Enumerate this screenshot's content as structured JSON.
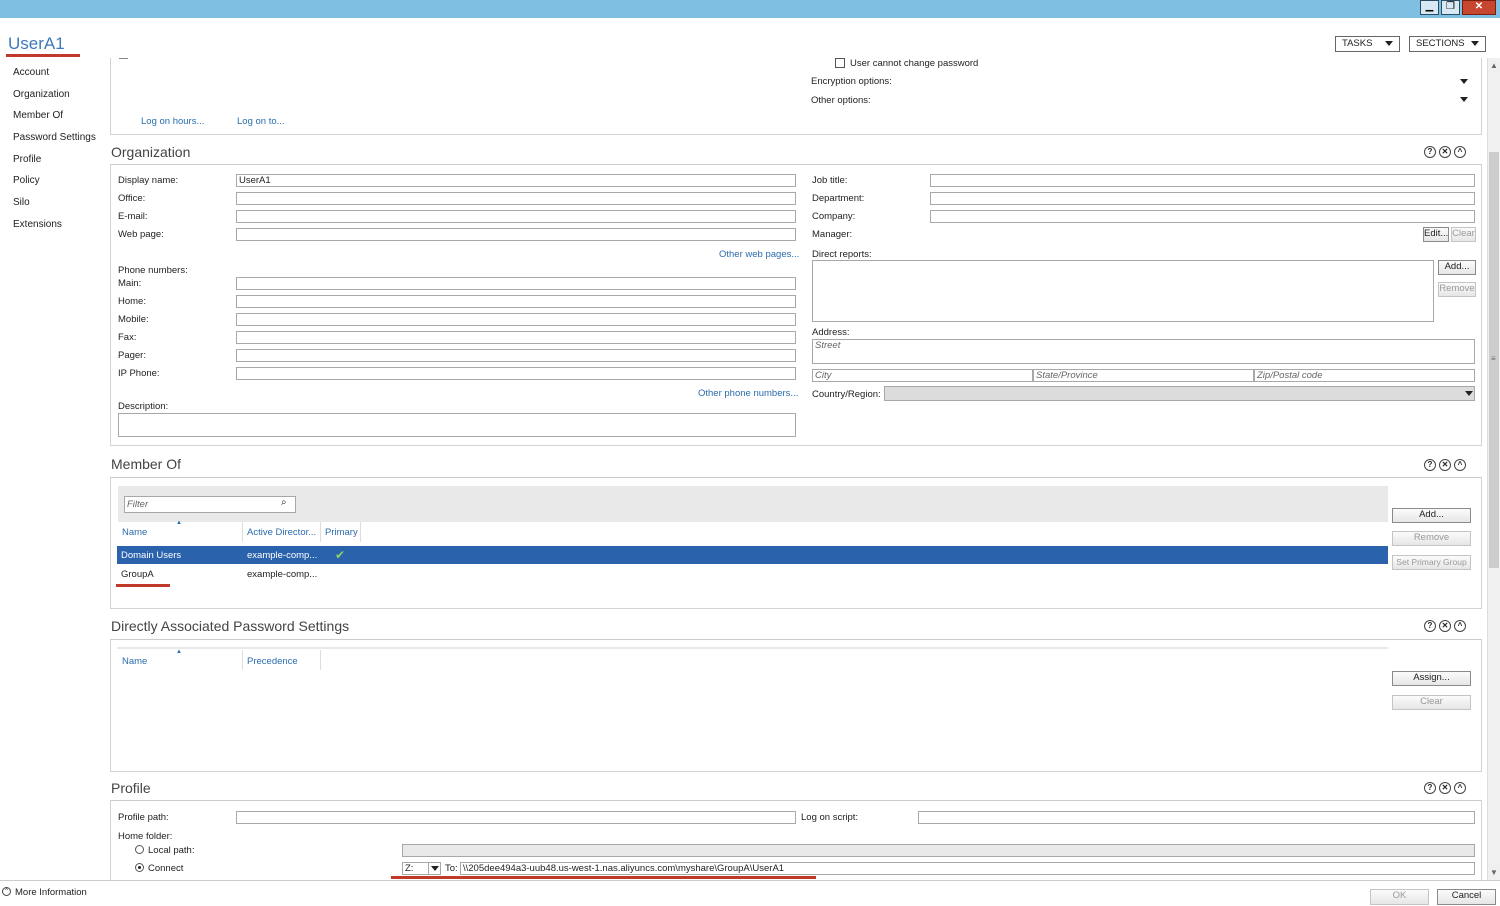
{
  "window": {
    "minimize": "▁",
    "restore": "❐",
    "close": "✕"
  },
  "header": {
    "title": "UserA1",
    "tasks": "TASKS",
    "sections": "SECTIONS"
  },
  "nav": [
    "Account",
    "Organization",
    "Member Of",
    "Password Settings",
    "Profile",
    "Policy",
    "Silo",
    "Extensions"
  ],
  "account": {
    "cannot_change_password": "User cannot change password",
    "encryption_options": "Encryption options:",
    "other_options": "Other options:",
    "log_on_hours": "Log on hours...",
    "log_on_to": "Log on to..."
  },
  "organization": {
    "title": "Organization",
    "display_name_label": "Display name:",
    "display_name_value": "UserA1",
    "office_label": "Office:",
    "email_label": "E-mail:",
    "web_page_label": "Web page:",
    "other_web_pages": "Other web pages...",
    "phone_numbers_label": "Phone numbers:",
    "main_label": "Main:",
    "home_label": "Home:",
    "mobile_label": "Mobile:",
    "fax_label": "Fax:",
    "pager_label": "Pager:",
    "ip_phone_label": "IP Phone:",
    "other_phone_numbers": "Other phone numbers...",
    "description_label": "Description:",
    "job_title_label": "Job title:",
    "department_label": "Department:",
    "company_label": "Company:",
    "manager_label": "Manager:",
    "edit": "Edit...",
    "clear": "Clear",
    "direct_reports_label": "Direct reports:",
    "add": "Add...",
    "remove": "Remove",
    "address_label": "Address:",
    "street_ph": "Street",
    "city_ph": "City",
    "state_ph": "State/Province",
    "zip_ph": "Zip/Postal code",
    "country_label": "Country/Region:"
  },
  "member_of": {
    "title": "Member Of",
    "filter_ph": "Filter",
    "col_name": "Name",
    "col_ad": "Active Director...",
    "col_primary": "Primary",
    "rows": [
      {
        "name": "Domain Users",
        "ad": "example-comp...",
        "primary": "✔"
      },
      {
        "name": "GroupA",
        "ad": "example-comp...",
        "primary": ""
      }
    ],
    "add": "Add...",
    "remove": "Remove",
    "set_primary": "Set Primary Group"
  },
  "password_settings": {
    "title": "Directly Associated Password Settings",
    "col_name": "Name",
    "col_precedence": "Precedence",
    "assign": "Assign...",
    "clear": "Clear"
  },
  "profile": {
    "title": "Profile",
    "profile_path_label": "Profile path:",
    "log_on_script_label": "Log on script:",
    "home_folder_label": "Home folder:",
    "local_path_label": "Local path:",
    "connect_label": "Connect",
    "drive": "Z:",
    "to_label": "To:",
    "to_value": "\\\\205dee494a3-uub48.us-west-1.nas.aliyuncs.com\\myshare\\GroupA\\UserA1"
  },
  "footer": {
    "more_info": "More Information",
    "ok": "OK",
    "cancel": "Cancel"
  },
  "colors": {
    "accent": "#3d7ab8",
    "selection": "#2a62ac",
    "underline": "#c0392b",
    "titlebar": "#7fbfe2"
  }
}
